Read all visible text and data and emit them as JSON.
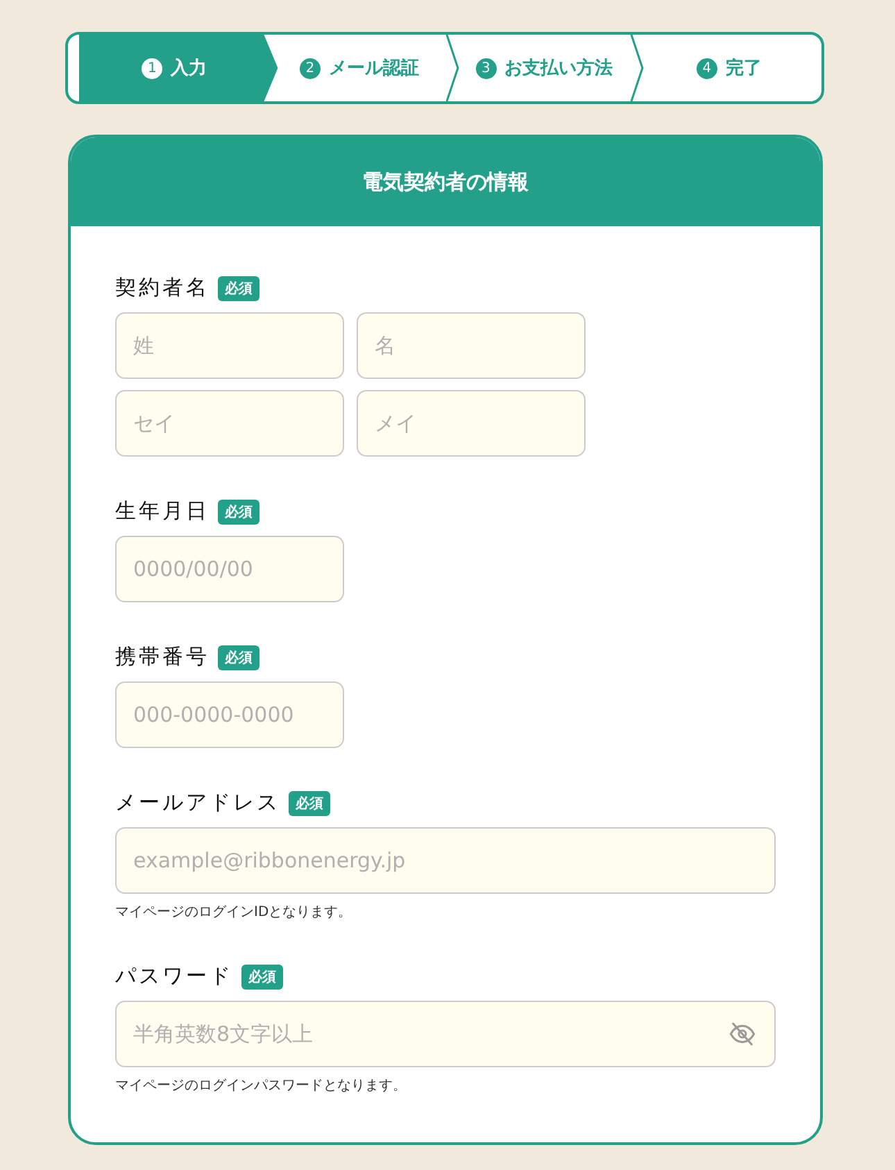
{
  "steps": [
    {
      "number": "1",
      "label": "入力",
      "selected": true
    },
    {
      "number": "2",
      "label": "メール認証",
      "selected": false
    },
    {
      "number": "3",
      "label": "お支払い方法",
      "selected": false
    },
    {
      "number": "4",
      "label": "完了",
      "selected": false
    }
  ],
  "card": {
    "title": "電気契約者の情報",
    "fields": [
      {
        "kind": "name",
        "label": "契約者名",
        "badge": "必須",
        "inputs": [
          {
            "placeholder": "姓"
          },
          {
            "placeholder": "名"
          },
          {
            "placeholder": "セイ"
          },
          {
            "placeholder": "メイ"
          }
        ]
      },
      {
        "kind": "short",
        "label": "生年月日",
        "badge": "必須",
        "inputs": [
          {
            "placeholder": "0000/00/00"
          }
        ]
      },
      {
        "kind": "short",
        "label": "携帯番号",
        "badge": "必須",
        "inputs": [
          {
            "placeholder": "000-0000-0000"
          }
        ]
      },
      {
        "kind": "wide",
        "label": "メールアドレス",
        "badge": "必須",
        "inputs": [
          {
            "placeholder": "example@ribbonenergy.jp"
          }
        ],
        "hint": "マイページのログインIDとなります。"
      },
      {
        "kind": "password",
        "label": "パスワード",
        "badge": "必須",
        "inputs": [
          {
            "placeholder": "半角英数8文字以上"
          }
        ],
        "hint": "マイページのログインパスワードとなります。"
      }
    ]
  }
}
